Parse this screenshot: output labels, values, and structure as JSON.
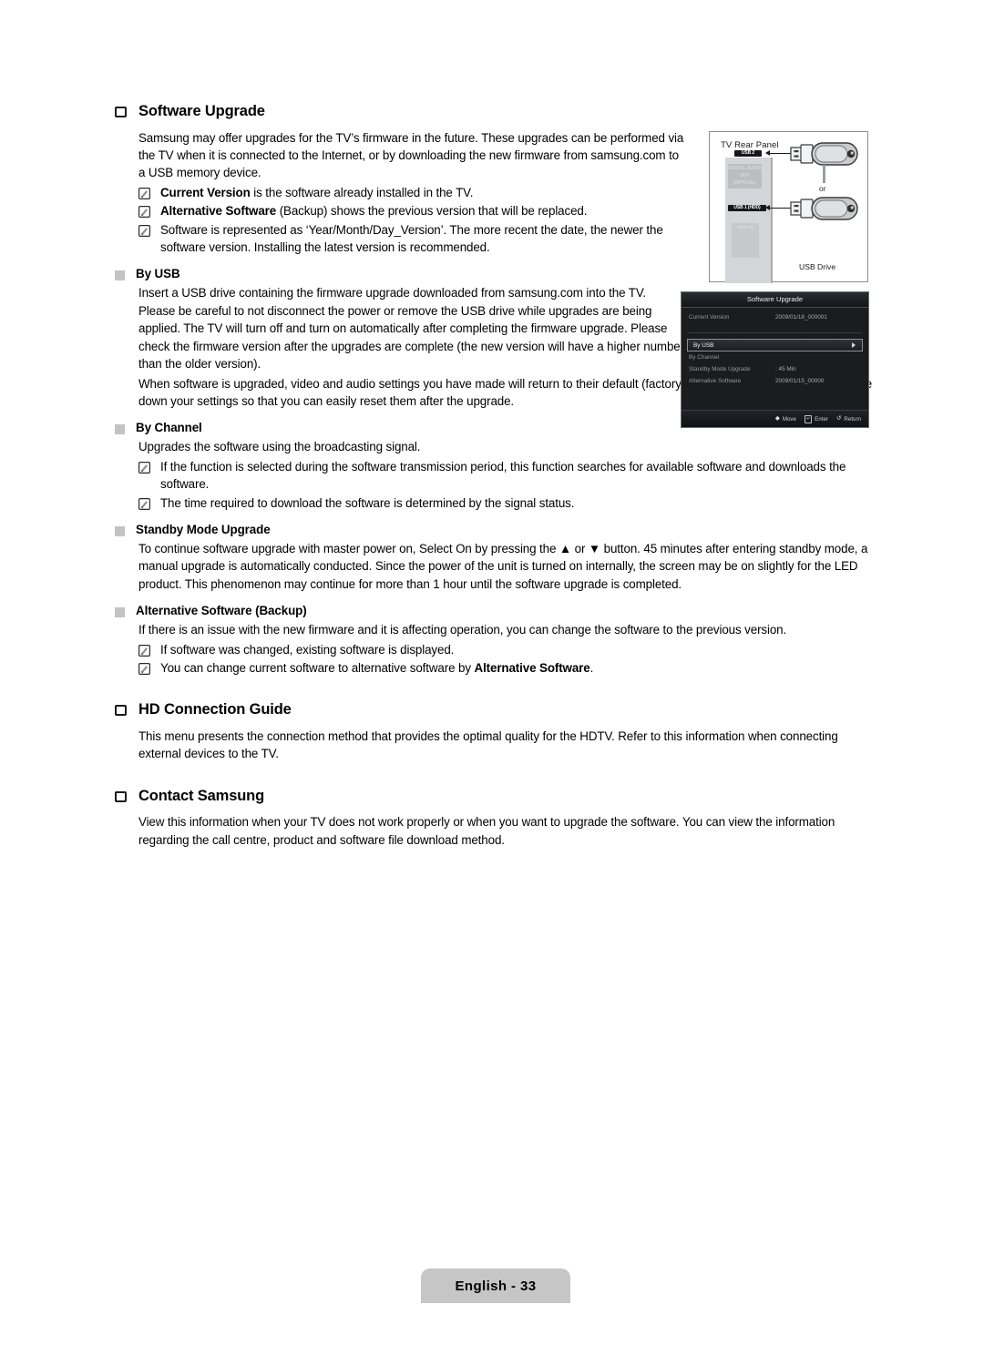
{
  "document": {
    "footer_label": "English - 33"
  },
  "sections": {
    "software_upgrade": {
      "heading": "Software Upgrade",
      "intro": "Samsung may offer upgrades for the TV’s firmware in the future. These upgrades can be performed via the TV when it is connected to the Internet, or by downloading the new firmware from samsung.com to a USB memory device.",
      "notes": [
        {
          "bold": "Current Version",
          "rest": " is the software already installed in the TV."
        },
        {
          "bold": "Alternative Software",
          "rest": " (Backup) shows the previous version that will be replaced."
        },
        {
          "bold": "",
          "rest": "Software is represented as ‘Year/Month/Day_Version’. The more recent the date, the newer the software version. Installing the latest version is recommended."
        }
      ]
    },
    "by_usb": {
      "heading": "By USB",
      "paragraph_1": "Insert a USB drive containing the firmware upgrade downloaded from samsung.com into the TV. Please be careful to not disconnect the power or remove the USB drive while upgrades are being applied. The TV will turn off and turn on automatically after completing the firmware upgrade. Please check the firmware version after the upgrades are complete (the new version will have a higher number than the older version).",
      "paragraph_2": "When software is upgraded, video and audio settings you have made will return to their default (factory) settings. We recommend you write down your settings so that you can easily reset them after the upgrade."
    },
    "by_channel": {
      "heading": "By Channel",
      "paragraph_1": "Upgrades the software using the broadcasting signal.",
      "notes": [
        "If the function is selected during the software transmission period, this function searches for available software and downloads the software.",
        "The time required to download the software is determined by the signal status."
      ]
    },
    "standby_mode_upgrade": {
      "heading": "Standby Mode Upgrade",
      "paragraph_1": "To continue software upgrade with master power on, Select On by pressing the ▲ or ▼ button. 45 minutes after entering standby mode, a manual upgrade is automatically conducted. Since the power of the unit is turned on internally, the screen may be on slightly for the LED product. This phenomenon may continue for more than 1 hour until the software upgrade is completed."
    },
    "alternative_software": {
      "heading": "Alternative Software (Backup)",
      "paragraph_1": "If there is an issue with the new firmware and it is affecting operation, you can change the software to the previous version.",
      "note_1": "If software was changed, existing software is displayed.",
      "note_2_pre": "You can change current software to alternative software by ",
      "note_2_bold": "Alternative Software",
      "note_2_post": "."
    },
    "hd_connection_guide": {
      "heading": "HD Connection Guide",
      "paragraph_1": "This menu presents the connection method that provides the optimal quality for the HDTV. Refer to this information when connecting external devices to the TV."
    },
    "contact_samsung": {
      "heading": "Contact Samsung",
      "paragraph_1": "View this information when your TV does not work properly or when you want to upgrade the software. You can view the information regarding the call centre, product and software file download method."
    }
  },
  "figure_rear_panel": {
    "title": "TV Rear Panel",
    "port_usb2": "USB 2",
    "port_optical": "DIGITAL AUDIO OUT (OPTICAL)",
    "port_usb1": "USB 1 (HDD)",
    "port_hdmi": "HDMI IN",
    "port_hdmi_number": "4",
    "or_label": "or",
    "usb_drive_label": "USB Drive"
  },
  "figure_osd": {
    "title": "Software Upgrade",
    "rows": [
      {
        "label": "Current Version",
        "value": "2009/01/18_000001"
      },
      {
        "label": "By USB",
        "value": ""
      },
      {
        "label": "By Channel",
        "value": ""
      },
      {
        "label": "Standby Mode Upgrade",
        "value": ": 45 Min"
      },
      {
        "label": "Alternative Software",
        "value": "2009/01/15_00000"
      }
    ],
    "footer": {
      "move": "Move",
      "enter": "Enter",
      "return": "Return"
    }
  },
  "colors": {
    "footer_bg": "#c6c6c6",
    "marker_gray": "#c3c3c3",
    "osd_bg": "#1b1c20",
    "tv_body": "#d3d5d8"
  }
}
